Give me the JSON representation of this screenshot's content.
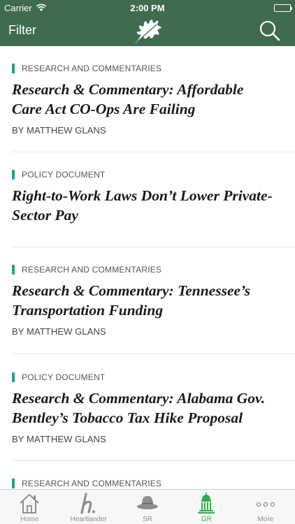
{
  "status": {
    "carrier": "Carrier",
    "time": "2:00 PM"
  },
  "nav": {
    "filter_label": "Filter",
    "logo_icon": "oak-leaf-icon",
    "search_icon": "search-icon"
  },
  "articles": [
    {
      "category": "RESEARCH AND COMMENTARIES",
      "title_lines": [
        "Research & Commentary: Affordable",
        "Care Act CO-Ops Are Failing"
      ],
      "byline": "BY MATTHEW GLANS"
    },
    {
      "category": "POLICY DOCUMENT",
      "title_lines": [
        "Right-to-Work Laws Don’t Lower Private-",
        "Sector Pay"
      ],
      "byline": ""
    },
    {
      "category": "RESEARCH AND COMMENTARIES",
      "title_lines": [
        "Research & Commentary: Tennessee’s",
        "Transportation Funding"
      ],
      "byline": "BY MATTHEW GLANS"
    },
    {
      "category": "POLICY DOCUMENT",
      "title_lines": [
        "Research & Commentary: Alabama Gov.",
        "Bentley’s Tobacco Tax Hike Proposal"
      ],
      "byline": "BY MATTHEW GLANS"
    },
    {
      "category": "RESEARCH AND COMMENTARIES",
      "title_lines": [],
      "byline": ""
    }
  ],
  "tabs": [
    {
      "label": "Home",
      "icon": "home-icon",
      "active": false
    },
    {
      "label": "Heartlander",
      "icon": "heartlander-h-icon",
      "active": false
    },
    {
      "label": "SR",
      "icon": "hat-icon",
      "active": false
    },
    {
      "label": "GR",
      "icon": "capitol-building-icon",
      "active": true
    },
    {
      "label": "More",
      "icon": "more-dots-icon",
      "active": false
    }
  ],
  "colors": {
    "nav_bg": "#3f6b4f",
    "accent_bar": "#2a9d8f",
    "active_tab": "#2eaf4a",
    "inactive_tab": "#8e8e8e"
  }
}
